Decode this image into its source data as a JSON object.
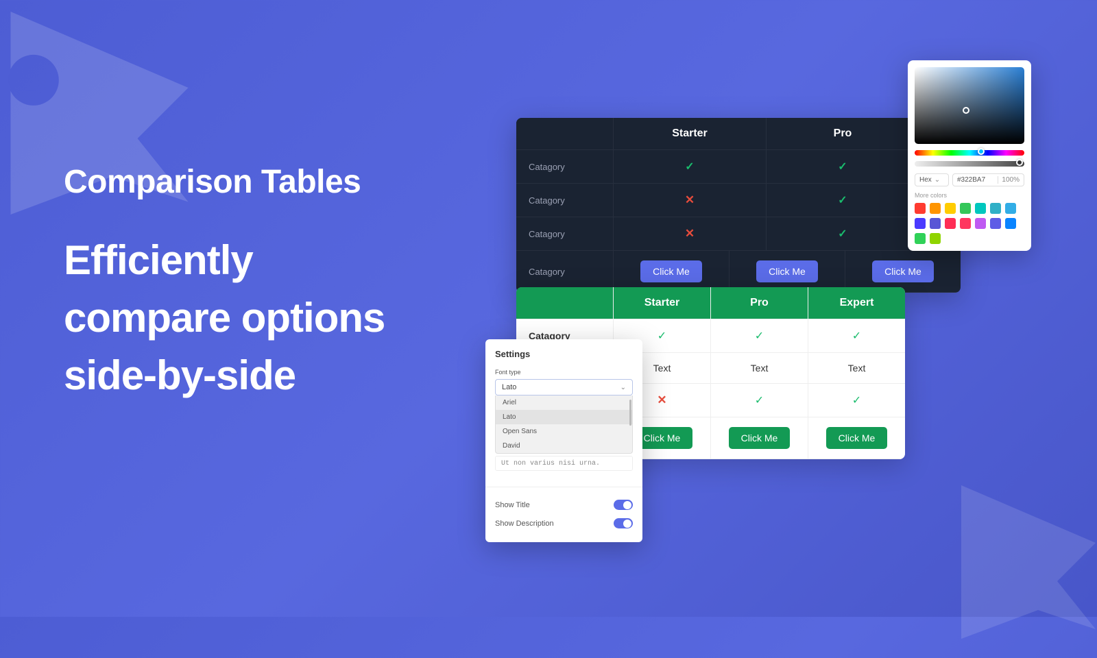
{
  "hero": {
    "title": "Comparison Tables",
    "subtitle": "Efficiently compare options side-by-side"
  },
  "dark_table": {
    "headers": [
      "Starter",
      "Pro"
    ],
    "row_label": "Catagory",
    "rows": [
      {
        "label": "Catagory",
        "cells": [
          {
            "type": "check"
          },
          {
            "type": "check"
          }
        ]
      },
      {
        "label": "Catagory",
        "cells": [
          {
            "type": "cross"
          },
          {
            "type": "check"
          }
        ]
      },
      {
        "label": "Catagory",
        "cells": [
          {
            "type": "cross"
          },
          {
            "type": "check"
          }
        ]
      },
      {
        "label": "Catagory",
        "cells": [
          {
            "type": "button",
            "text": "Click Me"
          },
          {
            "type": "button",
            "text": "Click Me"
          },
          {
            "type": "button",
            "text": "Click Me"
          }
        ]
      }
    ]
  },
  "light_table": {
    "headers": [
      "Starter",
      "Pro",
      "Expert"
    ],
    "rows": [
      {
        "label": "Catagory",
        "cells": [
          {
            "type": "check"
          },
          {
            "type": "check"
          },
          {
            "type": "check"
          }
        ]
      },
      {
        "label": "",
        "cells": [
          {
            "type": "text",
            "text": "Text"
          },
          {
            "type": "text",
            "text": "Text"
          },
          {
            "type": "text",
            "text": "Text"
          }
        ]
      },
      {
        "label": "",
        "cells": [
          {
            "type": "cross"
          },
          {
            "type": "check"
          },
          {
            "type": "check"
          }
        ]
      },
      {
        "label": "",
        "cells": [
          {
            "type": "button",
            "text": "Click Me"
          },
          {
            "type": "button",
            "text": "Click Me"
          },
          {
            "type": "button",
            "text": "Click Me"
          }
        ]
      }
    ]
  },
  "settings": {
    "title": "Settings",
    "font_type_label": "Font type",
    "font_selected": "Lato",
    "font_options": [
      "Ariel",
      "Lato",
      "Open Sans",
      "David"
    ],
    "textarea_value": "Ut non varius nisi urna.",
    "toggles": [
      {
        "label": "Show Title",
        "on": true
      },
      {
        "label": "Show Description",
        "on": true
      }
    ]
  },
  "picker": {
    "mode": "Hex",
    "value": "#322BA7",
    "alpha": "100%",
    "more_label": "More colors",
    "swatches": [
      "#ff3b30",
      "#ff9500",
      "#ffcc00",
      "#34c759",
      "#00c7be",
      "#30b0c7",
      "#32ade6",
      "#4a3aff",
      "#5856d6",
      "#ff2d55",
      "#ff375f",
      "#bf5af2",
      "#5e5ce6",
      "#0a84ff",
      "#30d158",
      "#8fd400"
    ]
  }
}
